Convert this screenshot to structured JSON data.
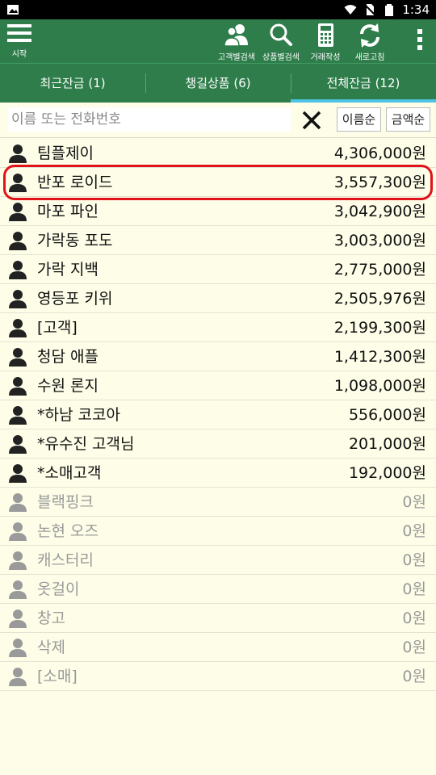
{
  "status_bar": {
    "time": "1:34",
    "icons": [
      "image-icon",
      "wifi-icon",
      "no-sim-icon",
      "battery-icon"
    ]
  },
  "toolbar": {
    "menu_label": "시작",
    "tools": [
      {
        "label": "고객별검색",
        "icon": "customer-search-icon"
      },
      {
        "label": "상품별검색",
        "icon": "product-search-icon"
      },
      {
        "label": "거래작성",
        "icon": "calculator-icon"
      },
      {
        "label": "새로고침",
        "icon": "refresh-icon"
      }
    ],
    "overflow_icon": "more-vertical-icon",
    "color": "#2e7d4a"
  },
  "tabs": [
    {
      "label": "최근잔금 (1)",
      "active": false
    },
    {
      "label": "챙길상품 (6)",
      "active": false
    },
    {
      "label": "전체잔금 (12)",
      "active": true
    }
  ],
  "search": {
    "value": "",
    "placeholder": "이름 또는 전화번호",
    "sort_name_label": "이름순",
    "sort_amount_label": "금액순"
  },
  "customers": [
    {
      "name": "팀플제이",
      "balance": "4,306,000원",
      "zero": false
    },
    {
      "name": "반포 로이드",
      "balance": "3,557,300원",
      "zero": false,
      "highlighted": true
    },
    {
      "name": "마포 파인",
      "balance": "3,042,900원",
      "zero": false
    },
    {
      "name": "가락동 포도",
      "balance": "3,003,000원",
      "zero": false
    },
    {
      "name": "가락 지백",
      "balance": "2,775,000원",
      "zero": false
    },
    {
      "name": "영등포 키위",
      "balance": "2,505,976원",
      "zero": false
    },
    {
      "name": "[고객]",
      "balance": "2,199,300원",
      "zero": false
    },
    {
      "name": "청담 애플",
      "balance": "1,412,300원",
      "zero": false
    },
    {
      "name": "수원 론지",
      "balance": "1,098,000원",
      "zero": false
    },
    {
      "name": "*하남 코코아",
      "balance": "556,000원",
      "zero": false
    },
    {
      "name": "*유수진 고객님",
      "balance": "201,000원",
      "zero": false
    },
    {
      "name": "*소매고객",
      "balance": "192,000원",
      "zero": false
    },
    {
      "name": "블랙핑크",
      "balance": "0원",
      "zero": true
    },
    {
      "name": "논현 오즈",
      "balance": "0원",
      "zero": true
    },
    {
      "name": "캐스터리",
      "balance": "0원",
      "zero": true
    },
    {
      "name": "옷걸이",
      "balance": "0원",
      "zero": true
    },
    {
      "name": "창고",
      "balance": "0원",
      "zero": true
    },
    {
      "name": "삭제",
      "balance": "0원",
      "zero": true
    },
    {
      "name": "[소매]",
      "balance": "0원",
      "zero": true
    }
  ],
  "colors": {
    "highlight_border": "#e0121a",
    "active_tab_indicator": "#4fc3e6",
    "zero_text": "#9a9a9a"
  }
}
